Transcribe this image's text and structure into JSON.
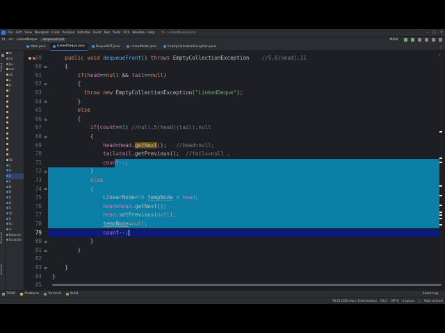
{
  "menubar": {
    "items": [
      "File",
      "Edit",
      "View",
      "Navigate",
      "Code",
      "Analyze",
      "Refactor",
      "Build",
      "Run",
      "Tools",
      "VCS",
      "Window",
      "Help"
    ],
    "title": "fa - LinkedDeque.java"
  },
  "navbar": {
    "crumbs": [
      "fa",
      "src",
      "LinkedDeque",
      "dequeueFront"
    ],
    "run_config": "MAIN"
  },
  "tabs": [
    {
      "label": "Main.java",
      "active": false
    },
    {
      "label": "LinkedDeque.java",
      "active": true
    },
    {
      "label": "DequeADT.java",
      "active": false
    },
    {
      "label": "LinearNode.java",
      "active": false
    },
    {
      "label": "EmptyCollectionException.java",
      "active": false
    }
  ],
  "left_strip": {
    "project_label": "Project",
    "structure_label": "Structure",
    "favorites_label": "Favorites"
  },
  "project_tree": [
    {
      "label": "fa",
      "color": "#dcb67a"
    },
    {
      "label": "Co",
      "color": "#8a8a8a"
    },
    {
      "label": "Jav",
      "color": "#8a8a8a"
    },
    {
      "label": "out",
      "color": "#dcb67a"
    },
    {
      "label": "ab",
      "color": "#dcb67a"
    },
    {
      "label": "e",
      "color": "#dcb67a"
    },
    {
      "label": "ja",
      "color": "#dcb67a"
    },
    {
      "label": "l",
      "color": "#dcb67a"
    },
    {
      "label": "",
      "color": "#dcb67a"
    },
    {
      "label": "",
      "color": "#dcb67a"
    },
    {
      "label": "",
      "color": "#dcb67a"
    },
    {
      "label": "",
      "color": "#dcb67a"
    },
    {
      "label": "",
      "color": "#dcb67a"
    },
    {
      "label": "",
      "color": "#dcb67a"
    },
    {
      "label": "",
      "color": "#dcb67a"
    },
    {
      "label": "",
      "color": "#dcb67a"
    },
    {
      "label": "",
      "color": "#dcb67a"
    },
    {
      "label": "",
      "color": "#dcb67a"
    },
    {
      "label": "",
      "color": "#dcb67a"
    },
    {
      "label": "",
      "color": "#dcb67a"
    },
    {
      "label": "Str",
      "color": "#dcb67a"
    },
    {
      "label": "C",
      "color": "#3d8fd1"
    },
    {
      "label": "In",
      "color": "#3d8fd1"
    },
    {
      "label": "Li",
      "color": "#3d8fd1",
      "selected": true
    },
    {
      "label": "Li",
      "color": "#3d8fd1"
    },
    {
      "label": "M",
      "color": "#3d8fd1"
    },
    {
      "label": "N",
      "color": "#3d8fd1"
    },
    {
      "label": "O",
      "color": "#3d8fd1"
    },
    {
      "label": "Q",
      "color": "#3d8fd1"
    },
    {
      "label": "S",
      "color": "#3d8fd1"
    },
    {
      "label": "St",
      "color": "#3d8fd1"
    },
    {
      "label": "S",
      "color": "#3d8fd1"
    },
    {
      "label": "Fu",
      "color": "#8a8a8a"
    },
    {
      "label": "in",
      "color": "#8a8a8a"
    },
    {
      "label": "External",
      "color": "#8a8a8a"
    },
    {
      "label": "Scratche",
      "color": "#8a8a8a"
    }
  ],
  "gutter": {
    "lines": [
      "59",
      "60",
      "61",
      "62",
      "63",
      "64",
      "65",
      "66",
      "67",
      "68",
      "69",
      "70",
      "71",
      "72",
      "73",
      "74",
      "75",
      "76",
      "77",
      "78",
      "79",
      "80",
      "81",
      "82",
      "83",
      "84",
      "85"
    ],
    "current": "79"
  },
  "code": [
    [
      {
        "t": "    "
      },
      {
        "t": "public ",
        "c": "kw"
      },
      {
        "t": "void ",
        "c": "kw"
      },
      {
        "t": "dequeueFront",
        "c": "fn"
      },
      {
        "t": "() "
      },
      {
        "t": "throws ",
        "c": "kw"
      },
      {
        "t": "EmptyCollectionException    "
      },
      {
        "t": "//5,6(head),11",
        "c": "cm"
      }
    ],
    [
      {
        "t": "    {"
      }
    ],
    [
      {
        "t": "        "
      },
      {
        "t": "if",
        "c": "kw"
      },
      {
        "t": "("
      },
      {
        "t": "head",
        "c": "fld"
      },
      {
        "t": "=="
      },
      {
        "t": "null ",
        "c": "kw"
      },
      {
        "t": "&& "
      },
      {
        "t": "tail",
        "c": "fld"
      },
      {
        "t": "=="
      },
      {
        "t": "null",
        "c": "kw"
      },
      {
        "t": ")"
      }
    ],
    [
      {
        "t": "        {"
      }
    ],
    [
      {
        "t": "          "
      },
      {
        "t": "throw ",
        "c": "kw"
      },
      {
        "t": "new ",
        "c": "kw"
      },
      {
        "t": "EmptyCollectionException("
      },
      {
        "t": "\"LinkedDeque\"",
        "c": "str"
      },
      {
        "t": ");"
      }
    ],
    [
      {
        "t": "        }"
      }
    ],
    [
      {
        "t": "        "
      },
      {
        "t": "else",
        "c": "kw"
      }
    ],
    [
      {
        "t": "        {"
      }
    ],
    [
      {
        "t": "            "
      },
      {
        "t": "if",
        "c": "kw"
      },
      {
        "t": "("
      },
      {
        "t": "count",
        "c": "fld"
      },
      {
        "t": "=="
      },
      {
        "t": "1",
        "c": "num"
      },
      {
        "t": ") "
      },
      {
        "t": "//null,5(head)(tail),null",
        "c": "cm"
      }
    ],
    [
      {
        "t": "            {"
      }
    ],
    [
      {
        "t": "                "
      },
      {
        "t": "head",
        "c": "fld"
      },
      {
        "t": "="
      },
      {
        "t": "head",
        "c": "fld"
      },
      {
        "t": "."
      },
      {
        "t": "getNext",
        "c": "hl-call"
      },
      {
        "t": "();   "
      },
      {
        "t": "//head=null;",
        "c": "cm"
      }
    ],
    [
      {
        "t": "                "
      },
      {
        "t": "tail",
        "c": "fld"
      },
      {
        "t": "="
      },
      {
        "t": "tail",
        "c": "fld"
      },
      {
        "t": ".getPrevious();  "
      },
      {
        "t": "//tail==null ,",
        "c": "cm"
      }
    ],
    [
      {
        "t": "                "
      },
      {
        "t": "count",
        "c": "fld"
      },
      {
        "t": "--;"
      }
    ],
    [
      {
        "t": "            }"
      }
    ],
    [
      {
        "t": "            "
      },
      {
        "t": "else",
        "c": "kw"
      }
    ],
    [
      {
        "t": "            {"
      }
    ],
    [
      {
        "t": "                LinearNode<"
      },
      {
        "t": "T",
        "c": "typ"
      },
      {
        "t": "> "
      },
      {
        "t": "tempNode",
        "c": "var"
      },
      {
        "t": " = "
      },
      {
        "t": "head",
        "c": "fld"
      },
      {
        "t": ";"
      }
    ],
    [
      {
        "t": "                "
      },
      {
        "t": "head",
        "c": "fld"
      },
      {
        "t": "="
      },
      {
        "t": "head",
        "c": "fld"
      },
      {
        "t": ".getNext();"
      }
    ],
    [
      {
        "t": "                "
      },
      {
        "t": "head",
        "c": "fld"
      },
      {
        "t": ".setPrevious("
      },
      {
        "t": "null",
        "c": "kw"
      },
      {
        "t": ");"
      }
    ],
    [
      {
        "t": "                "
      },
      {
        "t": "tempNode",
        "c": "var"
      },
      {
        "t": "="
      },
      {
        "t": "null",
        "c": "kw"
      },
      {
        "t": ";"
      }
    ],
    [
      {
        "t": "                "
      },
      {
        "t": "count",
        "c": "fld"
      },
      {
        "t": "--;"
      }
    ],
    [
      {
        "t": "            }"
      }
    ],
    [
      {
        "t": "        }"
      }
    ],
    [
      {
        "t": ""
      }
    ],
    [
      {
        "t": "    }"
      }
    ],
    [
      {
        "t": "}"
      }
    ],
    [
      {
        "t": ""
      }
    ]
  ],
  "bottom_tools": [
    "TODO",
    "Problems",
    "Terminal",
    "Build"
  ],
  "event_log": "Event Log",
  "status": {
    "position": "79:25 (236 chars, 8 line breaks)",
    "line_sep": "CRLF",
    "encoding": "UTF-8",
    "indent": "4 spaces",
    "highlight": "High contrast"
  },
  "colors": {
    "selection": "#0a7ea4",
    "current_line": "#0c1a7a",
    "accent": "#3574f0"
  }
}
